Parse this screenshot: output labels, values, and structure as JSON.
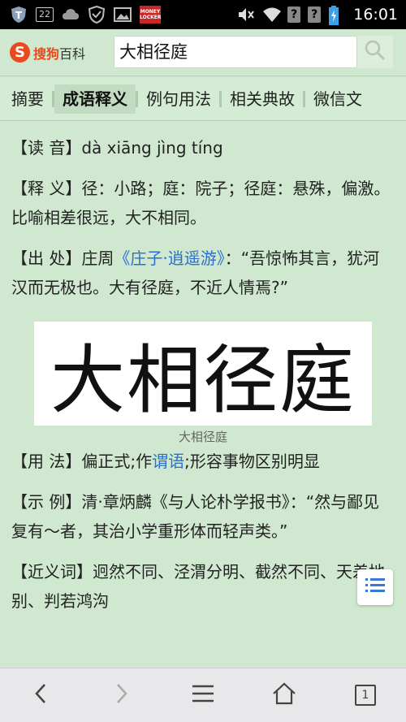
{
  "status_bar": {
    "notification_count": "22",
    "money_locker_label": "MONEY LOCKER",
    "sim1_label": "?",
    "sim2_label": "?",
    "time": "16:01"
  },
  "header": {
    "logo_brand": "搜狗",
    "logo_suffix": "百科",
    "search_value": "大相径庭"
  },
  "tabs": [
    {
      "label": "摘要",
      "active": false
    },
    {
      "label": "成语释义",
      "active": true
    },
    {
      "label": "例句用法",
      "active": false
    },
    {
      "label": "相关典故",
      "active": false
    },
    {
      "label": "微信文",
      "active": false
    }
  ],
  "entry": {
    "pronunciation": {
      "label": "【读 音】",
      "text": "dà xiāng jìng tíng"
    },
    "meaning": {
      "label": "【释 义】",
      "text": "径：小路；庭：院子；径庭：悬殊，偏激。比喻相差很远，大不相同。"
    },
    "source": {
      "label": "【出 处】",
      "author": "庄周",
      "book_link": "《庄子·逍遥游》",
      "quote": "：“吾惊怖其言，犹河汉而无极也。大有径庭，不近人情焉?”"
    },
    "figure": {
      "text": "大相径庭",
      "caption": "大相径庭"
    },
    "usage": {
      "label": "【用 法】",
      "pre": "偏正式;作",
      "link": "谓语",
      "post": ";形容事物区别明显"
    },
    "example": {
      "label": "【示 例】",
      "text": "清·章炳麟《与人论朴学报书》：“然与鄙见复有～者，其治小学重形体而轻声类。”"
    },
    "synonyms": {
      "label": "【近义词】",
      "text": "迥然不同、泾渭分明、截然不同、天差地别、判若鸿沟"
    }
  },
  "colors": {
    "background": "#cfe8cf",
    "link": "#2a6fd1",
    "logo": "#e8491d"
  },
  "bottom_bar": {
    "icons": [
      "back-icon",
      "forward-icon",
      "menu-icon",
      "home-icon",
      "tabs-icon"
    ],
    "tab_count": "1"
  }
}
